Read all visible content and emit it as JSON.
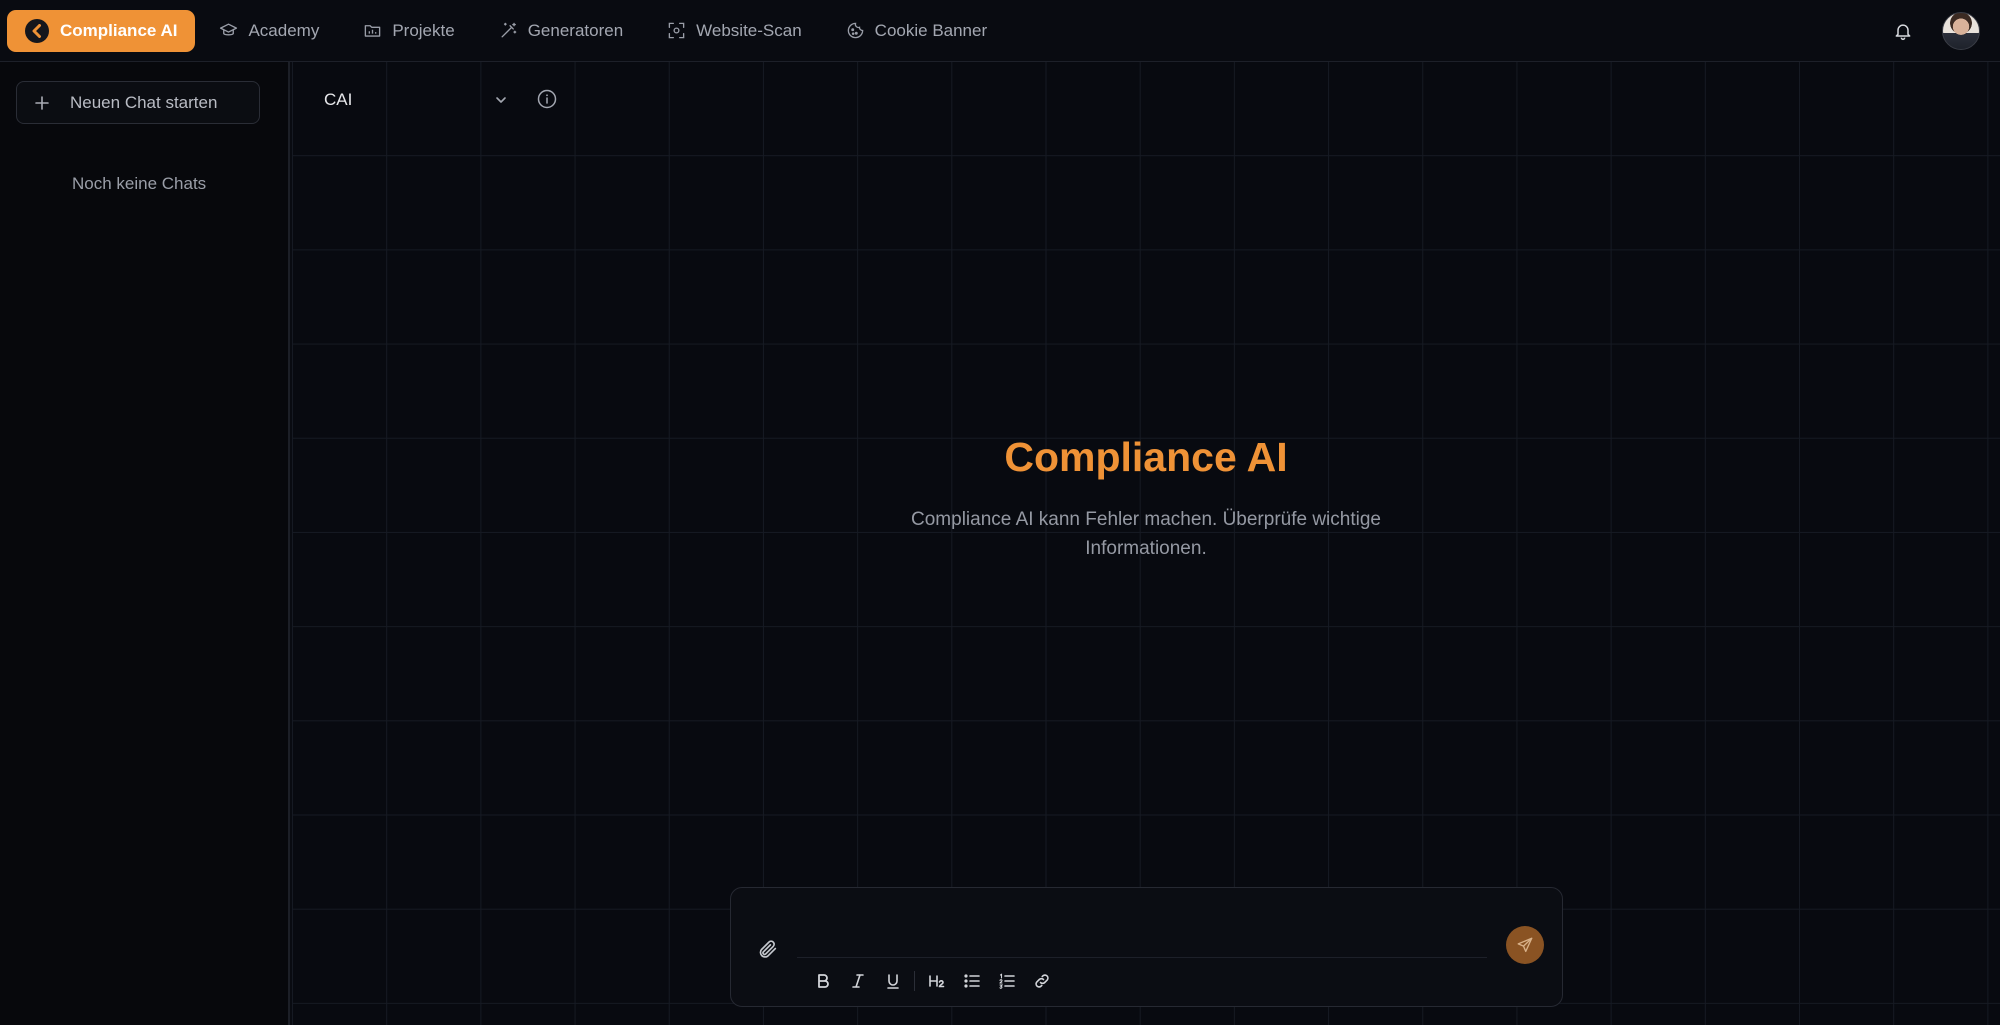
{
  "nav": {
    "items": [
      {
        "label": "Compliance AI",
        "icon": "compliance-ai-logo-icon",
        "active": true
      },
      {
        "label": "Academy",
        "icon": "graduation-cap-icon"
      },
      {
        "label": "Projekte",
        "icon": "folder-chart-icon"
      },
      {
        "label": "Generatoren",
        "icon": "magic-wand-icon"
      },
      {
        "label": "Website-Scan",
        "icon": "scan-icon"
      },
      {
        "label": "Cookie Banner",
        "icon": "cookie-icon"
      }
    ]
  },
  "sidebar": {
    "new_chat_label": "Neuen Chat starten",
    "empty_label": "Noch keine Chats"
  },
  "main": {
    "model": "CAI",
    "hero_title": "Compliance AI",
    "hero_subtitle": "Compliance AI kann Fehler machen. Überprüfe wichtige Informationen."
  },
  "composer": {
    "value": "",
    "placeholder": "",
    "format_tools": [
      "bold",
      "italic",
      "underline",
      "heading-2",
      "bullet-list",
      "numbered-list",
      "link"
    ]
  },
  "colors": {
    "accent": "#ef9236",
    "background": "#090b11",
    "send_button": "#8a5323"
  }
}
